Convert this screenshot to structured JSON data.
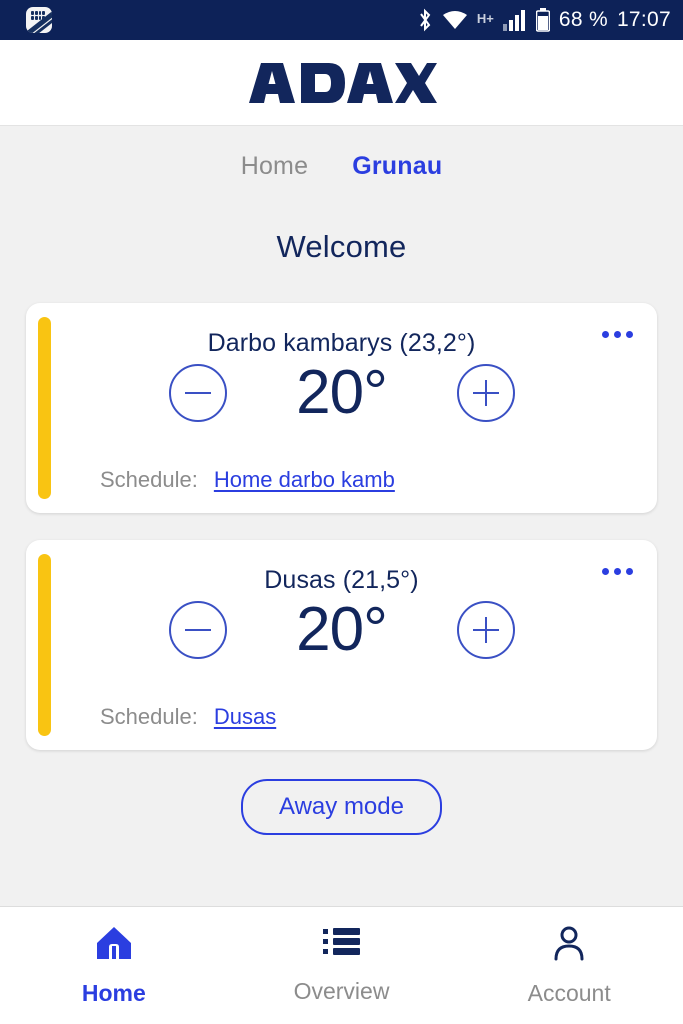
{
  "statusbar": {
    "app_icon": "app-notification-icon",
    "bluetooth_icon": "bluetooth-icon",
    "wifi_icon": "wifi-icon",
    "network_type": "H+",
    "signal_icon": "cellular-signal-icon",
    "battery_icon": "battery-icon",
    "battery_text": "68 %",
    "time": "17:07"
  },
  "header": {
    "logo_text": "ADAX"
  },
  "nav_tabs": [
    {
      "label": "Home",
      "active": false
    },
    {
      "label": "Grunau",
      "active": true
    }
  ],
  "page_title": "Welcome",
  "rooms": [
    {
      "title": "Darbo kambarys (23,2°)",
      "name": "Darbo kambarys",
      "current_temp": "23,2°",
      "target_temp": "20°",
      "schedule_label": "Schedule:",
      "schedule_link": "Home darbo kamb",
      "accent_color": "#f9c412",
      "decrease_label": "−",
      "increase_label": "+",
      "menu_label": "•••"
    },
    {
      "title": "Dusas (21,5°)",
      "name": "Dusas",
      "current_temp": "21,5°",
      "target_temp": "20°",
      "schedule_label": "Schedule:",
      "schedule_link": "Dusas",
      "accent_color": "#f9c412",
      "decrease_label": "−",
      "increase_label": "+",
      "menu_label": "•••"
    }
  ],
  "away_button": {
    "label": "Away mode"
  },
  "bottom_nav": [
    {
      "label": "Home",
      "icon": "home-icon",
      "active": true
    },
    {
      "label": "Overview",
      "icon": "list-icon",
      "active": false
    },
    {
      "label": "Account",
      "icon": "person-icon",
      "active": false
    }
  ],
  "colors": {
    "brand_navy": "#12265c",
    "accent_blue": "#2b3ee0",
    "accent_yellow": "#f9c412",
    "muted_gray": "#8c8c8c",
    "page_bg": "#f1f1f1",
    "statusbar_bg": "#0d2258"
  }
}
